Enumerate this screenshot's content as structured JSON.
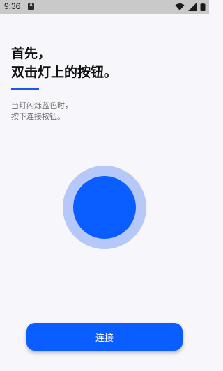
{
  "status_bar": {
    "time": "9:36",
    "app_icon": "A",
    "icons": [
      "wifi-icon",
      "signal-icon",
      "battery-icon"
    ]
  },
  "heading": {
    "line1": "首先，",
    "line2": "双击灯上的按钮。"
  },
  "instructions": {
    "line1": "当灯闪烁蓝色时，",
    "line2": "按下连接按钮。"
  },
  "connect_button": {
    "label": "连接"
  },
  "colors": {
    "accent": "#0a5eff",
    "accent_light": "#b5c8f8",
    "background": "#f7f6fa"
  }
}
